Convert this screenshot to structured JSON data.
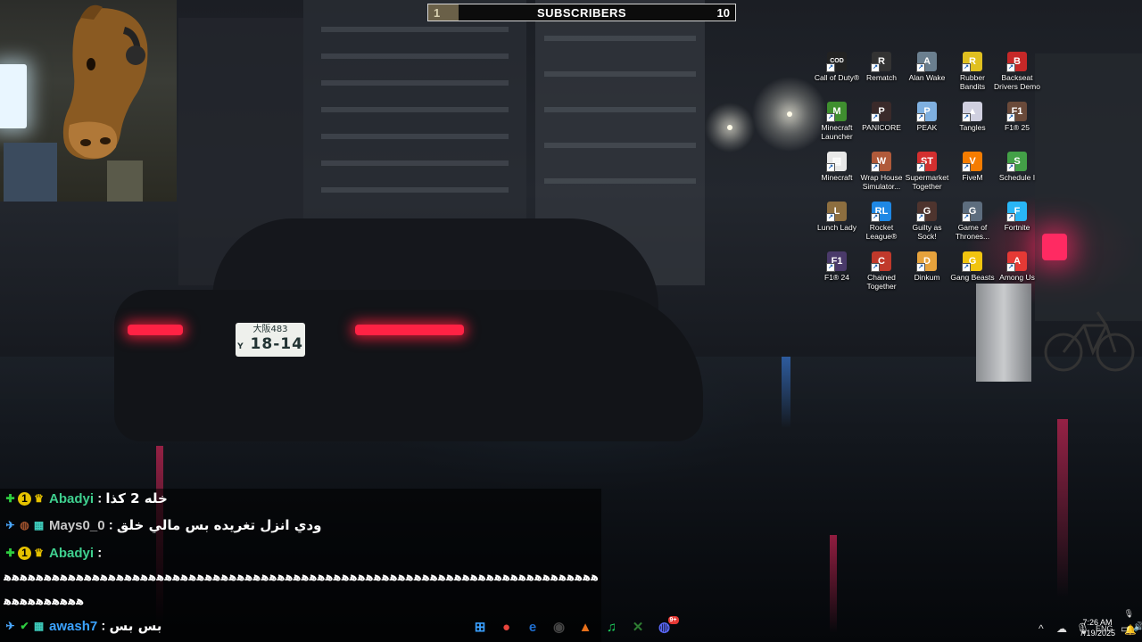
{
  "subscribers": {
    "current": "1",
    "label": "SUBSCRIBERS",
    "goal": "10",
    "progress_fraction": 0.1
  },
  "wallpaper": {
    "plate_top": "大阪483",
    "plate_prefix": "Y",
    "plate_number": "18-14"
  },
  "desktop_icons": [
    {
      "label": "Call of Duty®",
      "icon": "call-of-duty-icon",
      "color": "#222222",
      "glyph": "COD"
    },
    {
      "label": "Rematch",
      "icon": "rematch-icon",
      "color": "#333333",
      "glyph": "R"
    },
    {
      "label": "Alan Wake",
      "icon": "alan-wake-icon",
      "color": "#6b7f8f",
      "glyph": "A"
    },
    {
      "label": "Rubber Bandits",
      "icon": "rubber-bandits-icon",
      "color": "#e0c020",
      "glyph": "R"
    },
    {
      "label": "Backseat Drivers Demo",
      "icon": "backseat-drivers-icon",
      "color": "#c62828",
      "glyph": "B"
    },
    {
      "label": "Minecraft Launcher",
      "icon": "minecraft-launcher-icon",
      "color": "#3f8f2f",
      "glyph": "M"
    },
    {
      "label": "PANICORE",
      "icon": "panicore-icon",
      "color": "#3a2a2a",
      "glyph": "P"
    },
    {
      "label": "PEAK",
      "icon": "peak-icon",
      "color": "#7fb0e0",
      "glyph": "P"
    },
    {
      "label": "Tangles",
      "icon": "tangles-icon",
      "color": "#d0d0e0",
      "glyph": "▲"
    },
    {
      "label": "F1® 25",
      "icon": "f1-25-icon",
      "color": "#6a4a3a",
      "glyph": "F1"
    },
    {
      "label": "Minecraft",
      "icon": "minecraft-icon",
      "color": "#e8e8e8",
      "glyph": "▤"
    },
    {
      "label": "Wrap House Simulator...",
      "icon": "wrap-house-icon",
      "color": "#b05a3a",
      "glyph": "W"
    },
    {
      "label": "Supermarket Together",
      "icon": "supermarket-together-icon",
      "color": "#d32f2f",
      "glyph": "ST"
    },
    {
      "label": "FiveM",
      "icon": "fivem-icon",
      "color": "#f57c00",
      "glyph": "V"
    },
    {
      "label": "Schedule I",
      "icon": "schedule-i-icon",
      "color": "#43a047",
      "glyph": "S"
    },
    {
      "label": "Lunch Lady",
      "icon": "lunch-lady-icon",
      "color": "#8d6e3f",
      "glyph": "L"
    },
    {
      "label": "Rocket League®",
      "icon": "rocket-league-icon",
      "color": "#1e88e5",
      "glyph": "RL"
    },
    {
      "label": "Guilty as Sock!",
      "icon": "guilty-as-sock-icon",
      "color": "#4e342e",
      "glyph": "G"
    },
    {
      "label": "Game of Thrones...",
      "icon": "game-of-thrones-icon",
      "color": "#5d6d7e",
      "glyph": "G"
    },
    {
      "label": "Fortnite",
      "icon": "fortnite-icon",
      "color": "#29b6f6",
      "glyph": "F"
    },
    {
      "label": "F1® 24",
      "icon": "f1-24-icon",
      "color": "#4a3a6a",
      "glyph": "F1"
    },
    {
      "label": "Chained Together",
      "icon": "chained-together-icon",
      "color": "#c0392b",
      "glyph": "C"
    },
    {
      "label": "Dinkum",
      "icon": "dinkum-icon",
      "color": "#e6a23c",
      "glyph": "D"
    },
    {
      "label": "Gang Beasts",
      "icon": "gang-beasts-icon",
      "color": "#f1c40f",
      "glyph": "G"
    },
    {
      "label": "Among Us",
      "icon": "among-us-icon",
      "color": "#e53935",
      "glyph": "A"
    }
  ],
  "chat": {
    "messages": [
      {
        "badges": [
          "prime-icon",
          "sub-badge-icon",
          "crown-icon"
        ],
        "name": "Abadyi",
        "name_color": "#3fd08f",
        "sep": ":",
        "text": "خله 2 كذا"
      },
      {
        "badges": [
          "pin-icon",
          "clock-badge-icon",
          "grid-badge-icon"
        ],
        "name": "Mays0_0",
        "name_color": "#c8c8c8",
        "sep": ":",
        "text": "ودي انزل تغريده بس مالي خلق"
      },
      {
        "badges": [
          "prime-icon",
          "sub-badge-icon",
          "crown-icon"
        ],
        "name": "Abadyi",
        "name_color": "#3fd08f",
        "sep": ":",
        "text": ""
      },
      {
        "badges": [
          "pin-icon",
          "check-badge-icon",
          "grid-badge-icon"
        ],
        "name": "awash7",
        "name_color": "#3ba3ff",
        "sep": ":",
        "text": "بس بس"
      }
    ],
    "spam_line_1": "ﻫﻫﻫﻫﻫﻫﻫﻫﻫﻫﻫﻫﻫﻫﻫﻫﻫﻫﻫﻫﻫﻫﻫﻫﻫﻫﻫﻫﻫﻫﻫﻫﻫﻫﻫﻫﻫﻫﻫﻫﻫﻫﻫﻫﻫﻫﻫﻫﻫﻫﻫﻫﻫﻫﻫﻫﻫﻫﻫﻫﻫﻫﻫﻫﻫﻫﻫﻫﻫﻫﻫﻫﻫﻫﻫﻫﻫﻫﻫﻫﻫﻫ",
    "spam_line_2": "ﻫﻫﻫﻫﻫﻫﻫﻫﻫﻫﻫ"
  },
  "taskbar": {
    "apps": [
      {
        "name": "start-button",
        "glyph": "⊞",
        "color": "#3aa0ff"
      },
      {
        "name": "chrome-icon",
        "glyph": "●",
        "color": "#e8453c"
      },
      {
        "name": "edge-icon",
        "glyph": "e",
        "color": "#1f6fd0"
      },
      {
        "name": "obs-icon",
        "glyph": "◉",
        "color": "#444444"
      },
      {
        "name": "vlc-icon",
        "glyph": "▲",
        "color": "#e8701a"
      },
      {
        "name": "spotify-icon",
        "glyph": "♫",
        "color": "#1ed760"
      },
      {
        "name": "xbox-icon",
        "glyph": "✕",
        "color": "#2e7d32"
      },
      {
        "name": "discord-icon",
        "glyph": "◍",
        "color": "#5865f2",
        "badge": "9+"
      }
    ],
    "tray": {
      "language": "ENG",
      "chevron": "^"
    },
    "time": "7:26 AM",
    "date": "7/19/2025"
  }
}
